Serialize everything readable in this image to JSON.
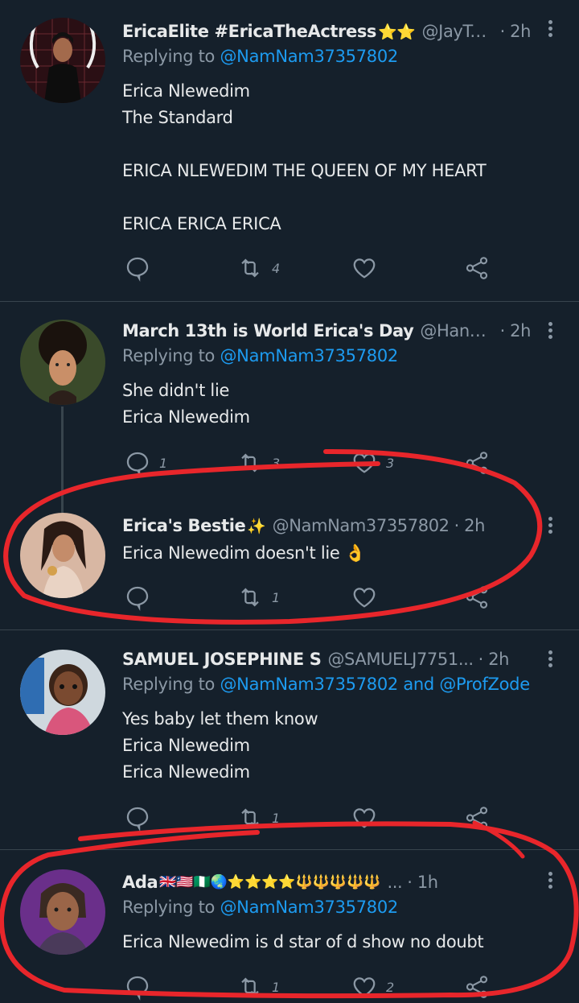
{
  "reply_prefix": "Replying to",
  "tweets": [
    {
      "name": "EricaElite #EricaTheActress",
      "emoji": "⭐⭐",
      "handle": "@JayTe...",
      "time": "· 2h",
      "reply_to": "@NamNam37357802",
      "body": "Erica Nlewedim\nThe Standard\n\nERICA NLEWEDIM THE QUEEN OF MY HEART\n\nERICA ERICA ERICA",
      "retweets": "4",
      "likes": ""
    },
    {
      "name": "March 13th is World Erica's Day",
      "emoji": "",
      "handle": "@Hanniel...",
      "time": "· 2h",
      "reply_to": "@NamNam37357802",
      "body": "She didn't lie\nErica Nlewedim",
      "replies": "1",
      "retweets": "3",
      "likes": "3"
    },
    {
      "name": "Erica's Bestie",
      "emoji": "✨",
      "handle": "@NamNam37357802",
      "time": "· 2h",
      "body": "Erica Nlewedim doesn't lie 👌",
      "retweets": "1"
    },
    {
      "name": "SAMUEL JOSEPHINE S",
      "emoji": "",
      "handle": "@SAMUELJ7751...",
      "time": "· 2h",
      "reply_to": "@NamNam37357802",
      "reply_and": "and",
      "reply_to2": "@ProfZode",
      "body": "Yes baby let them know\nErica Nlewedim\nErica Nlewedim",
      "retweets": "1"
    },
    {
      "name": "Ada",
      "emoji": "🇬🇧🇱🇷🇳🇬🌏⭐⭐⭐⭐🔱🔱🔱🔱🔱",
      "handle": "...",
      "time": "· 1h",
      "reply_to": "@NamNam37357802",
      "body": "Erica Nlewedim is d star of d show no doubt",
      "retweets": "1",
      "likes": "2"
    }
  ],
  "colors": {
    "background": "#15202b",
    "text": "#e7e9ea",
    "muted": "#8b98a5",
    "link": "#1d9bf0",
    "annotation": "#e8262b"
  }
}
